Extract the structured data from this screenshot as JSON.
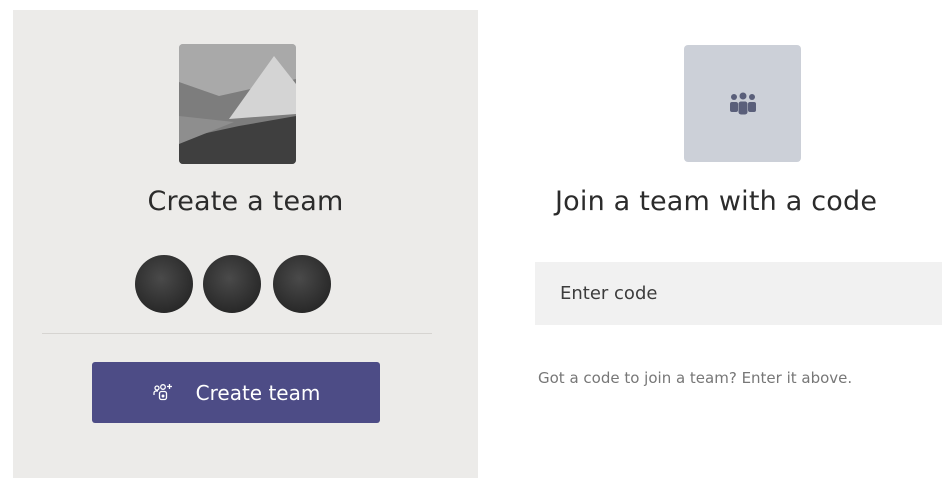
{
  "create_card": {
    "title": "Create a team",
    "button_label": "Create team",
    "avatar_count": 3,
    "icons": {
      "thumbnail": "team-placeholder-image",
      "button": "add-people-icon"
    }
  },
  "join_card": {
    "title": "Join a team with a code",
    "code_input": {
      "value": "",
      "placeholder": "Enter code"
    },
    "hint": "Got a code to join a team? Enter it above.",
    "icons": {
      "thumbnail": "people-group-icon"
    }
  },
  "colors": {
    "create_card_bg": "#ecebe9",
    "button_bg": "#4d4c86",
    "join_thumb_bg": "#ccd0d8",
    "input_bg": "#f1f1f1"
  }
}
